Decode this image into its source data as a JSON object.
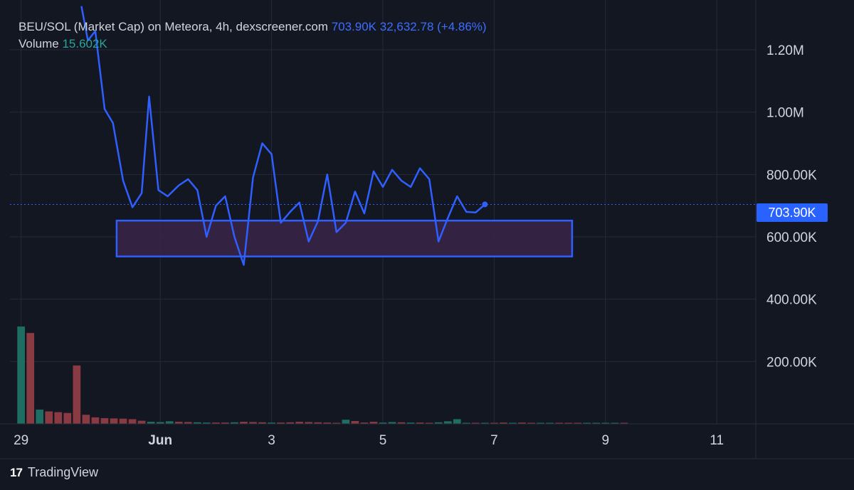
{
  "legend": {
    "title": "BEU/SOL (Market Cap) on Meteora, 4h, dexscreener.com",
    "last": "703.90K",
    "change": "32,632.78 (+4.86%)",
    "volume_label": "Volume",
    "volume_value": "15.602K"
  },
  "brand": {
    "logo": "17",
    "name": "TradingView"
  },
  "price_badge": "703.90K",
  "colors": {
    "background": "#131722",
    "line": "#2f5fff",
    "grid": "#242a38",
    "vol_up": "#1f6e63",
    "vol_down": "#8a3a43",
    "zone_fill": "#3a2548",
    "zone_stroke": "#2f5fff"
  },
  "chart_data": {
    "type": "line",
    "title": "BEU/SOL (Market Cap) on Meteora, 4h, dexscreener.com",
    "ylim": [
      0,
      1300000
    ],
    "y_ticks": [
      {
        "label": "1.20M",
        "value": 1200000
      },
      {
        "label": "1.00M",
        "value": 1000000
      },
      {
        "label": "800.00K",
        "value": 800000
      },
      {
        "label": "600.00K",
        "value": 600000
      },
      {
        "label": "400.00K",
        "value": 400000
      },
      {
        "label": "200.00K",
        "value": 200000
      }
    ],
    "x_ticks": [
      {
        "label": "29",
        "x": 0
      },
      {
        "label": "Jun",
        "x": 15
      },
      {
        "label": "3",
        "x": 27
      },
      {
        "label": "5",
        "x": 39
      },
      {
        "label": "7",
        "x": 51
      },
      {
        "label": "9",
        "x": 63
      },
      {
        "label": "11",
        "x": 75
      }
    ],
    "x_range": [
      -1.2,
      79.2
    ],
    "series": [
      {
        "values": [
          [
            6.5,
            1340000
          ],
          [
            7.2,
            1230000
          ],
          [
            8,
            1260000
          ],
          [
            9,
            1010000
          ],
          [
            9.9,
            965000
          ],
          [
            11,
            780000
          ],
          [
            12,
            695000
          ],
          [
            13,
            740000
          ],
          [
            13.8,
            1050000
          ],
          [
            14.8,
            750000
          ],
          [
            15.8,
            730000
          ],
          [
            17,
            765000
          ],
          [
            18,
            785000
          ],
          [
            19,
            750000
          ],
          [
            20,
            600000
          ],
          [
            21,
            700000
          ],
          [
            22,
            730000
          ],
          [
            23,
            600000
          ],
          [
            24,
            510000
          ],
          [
            25,
            790000
          ],
          [
            26,
            900000
          ],
          [
            27,
            865000
          ],
          [
            28,
            645000
          ],
          [
            29,
            680000
          ],
          [
            30,
            710000
          ],
          [
            31,
            585000
          ],
          [
            32,
            650000
          ],
          [
            33,
            800000
          ],
          [
            34,
            615000
          ],
          [
            35,
            645000
          ],
          [
            36,
            745000
          ],
          [
            37,
            675000
          ],
          [
            38,
            810000
          ],
          [
            39,
            760000
          ],
          [
            40,
            815000
          ],
          [
            41,
            780000
          ],
          [
            42,
            760000
          ],
          [
            43,
            820000
          ],
          [
            44,
            785000
          ],
          [
            45,
            585000
          ],
          [
            46,
            660000
          ],
          [
            47,
            730000
          ],
          [
            48,
            680000
          ],
          [
            49,
            678000
          ],
          [
            50,
            704000
          ]
        ]
      }
    ],
    "last_value": 703900,
    "annotations": [
      {
        "type": "rectangle",
        "x": [
          10.3,
          59.4
        ],
        "y": [
          537000,
          652000
        ]
      }
    ],
    "volume": {
      "label": "Volume",
      "ylim": [
        0,
        400000
      ],
      "bars": [
        {
          "x": 0,
          "v": 375000,
          "dir": "up"
        },
        {
          "x": 1,
          "v": 350000,
          "dir": "down"
        },
        {
          "x": 2,
          "v": 55000,
          "dir": "up"
        },
        {
          "x": 3,
          "v": 48000,
          "dir": "down"
        },
        {
          "x": 4,
          "v": 45000,
          "dir": "down"
        },
        {
          "x": 5,
          "v": 42000,
          "dir": "down"
        },
        {
          "x": 6,
          "v": 225000,
          "dir": "down"
        },
        {
          "x": 7,
          "v": 35000,
          "dir": "down"
        },
        {
          "x": 8,
          "v": 25000,
          "dir": "down"
        },
        {
          "x": 9,
          "v": 22000,
          "dir": "down"
        },
        {
          "x": 10,
          "v": 21000,
          "dir": "down"
        },
        {
          "x": 11,
          "v": 20000,
          "dir": "down"
        },
        {
          "x": 12,
          "v": 18000,
          "dir": "down"
        },
        {
          "x": 13,
          "v": 12000,
          "dir": "down"
        },
        {
          "x": 14,
          "v": 8000,
          "dir": "up"
        },
        {
          "x": 15,
          "v": 7000,
          "dir": "up"
        },
        {
          "x": 16,
          "v": 10000,
          "dir": "up"
        },
        {
          "x": 17,
          "v": 8000,
          "dir": "down"
        },
        {
          "x": 18,
          "v": 7000,
          "dir": "down"
        },
        {
          "x": 19,
          "v": 6000,
          "dir": "up"
        },
        {
          "x": 20,
          "v": 5000,
          "dir": "up"
        },
        {
          "x": 21,
          "v": 5000,
          "dir": "down"
        },
        {
          "x": 22,
          "v": 5000,
          "dir": "down"
        },
        {
          "x": 23,
          "v": 6000,
          "dir": "up"
        },
        {
          "x": 24,
          "v": 8000,
          "dir": "down"
        },
        {
          "x": 25,
          "v": 7000,
          "dir": "down"
        },
        {
          "x": 26,
          "v": 6000,
          "dir": "down"
        },
        {
          "x": 27,
          "v": 5000,
          "dir": "up"
        },
        {
          "x": 28,
          "v": 5000,
          "dir": "down"
        },
        {
          "x": 29,
          "v": 6000,
          "dir": "down"
        },
        {
          "x": 30,
          "v": 8000,
          "dir": "down"
        },
        {
          "x": 31,
          "v": 7000,
          "dir": "down"
        },
        {
          "x": 32,
          "v": 6000,
          "dir": "down"
        },
        {
          "x": 33,
          "v": 5000,
          "dir": "down"
        },
        {
          "x": 34,
          "v": 4000,
          "dir": "down"
        },
        {
          "x": 35,
          "v": 16000,
          "dir": "up"
        },
        {
          "x": 36,
          "v": 11000,
          "dir": "down"
        },
        {
          "x": 37,
          "v": 5000,
          "dir": "down"
        },
        {
          "x": 38,
          "v": 8000,
          "dir": "down"
        },
        {
          "x": 39,
          "v": 5000,
          "dir": "up"
        },
        {
          "x": 40,
          "v": 7000,
          "dir": "up"
        },
        {
          "x": 41,
          "v": 6000,
          "dir": "down"
        },
        {
          "x": 42,
          "v": 5000,
          "dir": "up"
        },
        {
          "x": 43,
          "v": 5000,
          "dir": "down"
        },
        {
          "x": 44,
          "v": 4000,
          "dir": "down"
        },
        {
          "x": 45,
          "v": 6000,
          "dir": "up"
        },
        {
          "x": 46,
          "v": 10000,
          "dir": "up"
        },
        {
          "x": 47,
          "v": 18000,
          "dir": "up"
        },
        {
          "x": 48,
          "v": 4000,
          "dir": "up"
        },
        {
          "x": 49,
          "v": 4000,
          "dir": "down"
        },
        {
          "x": 50,
          "v": 3000,
          "dir": "up"
        },
        {
          "x": 51,
          "v": 3000,
          "dir": "down"
        },
        {
          "x": 52,
          "v": 5000,
          "dir": "down"
        },
        {
          "x": 53,
          "v": 4000,
          "dir": "up"
        },
        {
          "x": 54,
          "v": 5000,
          "dir": "down"
        },
        {
          "x": 55,
          "v": 4000,
          "dir": "down"
        },
        {
          "x": 56,
          "v": 3000,
          "dir": "up"
        },
        {
          "x": 57,
          "v": 3000,
          "dir": "up"
        },
        {
          "x": 58,
          "v": 3000,
          "dir": "down"
        },
        {
          "x": 59,
          "v": 3000,
          "dir": "down"
        },
        {
          "x": 60,
          "v": 4000,
          "dir": "down"
        },
        {
          "x": 61,
          "v": 3000,
          "dir": "up"
        },
        {
          "x": 62,
          "v": 3000,
          "dir": "up"
        },
        {
          "x": 63,
          "v": 3000,
          "dir": "up"
        },
        {
          "x": 64,
          "v": 2000,
          "dir": "up"
        },
        {
          "x": 65,
          "v": 2000,
          "dir": "down"
        }
      ]
    },
    "grid": true,
    "legend_position": "top-left"
  }
}
